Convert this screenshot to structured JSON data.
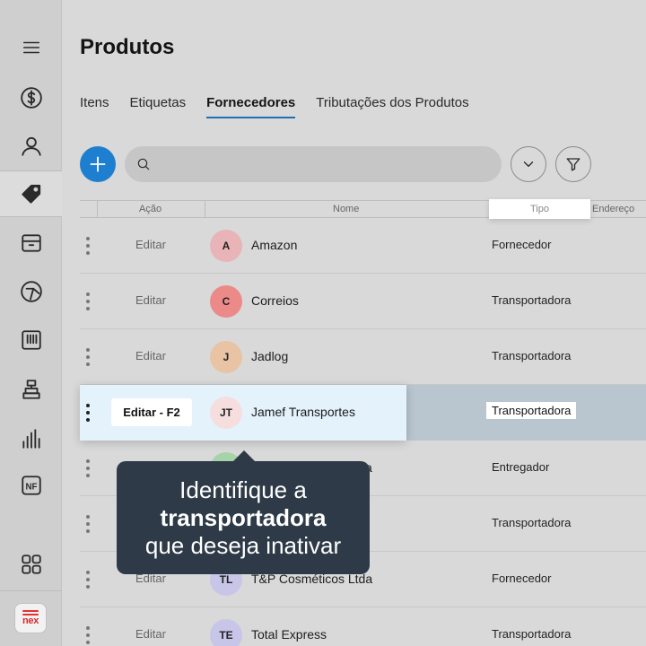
{
  "page": {
    "title": "Produtos"
  },
  "tabs": [
    {
      "label": "Itens",
      "active": false
    },
    {
      "label": "Etiquetas",
      "active": false
    },
    {
      "label": "Fornecedores",
      "active": true
    },
    {
      "label": "Tributações dos Produtos",
      "active": false
    }
  ],
  "sidebar": {
    "items": [
      {
        "icon": "menu-icon"
      },
      {
        "icon": "dollar-icon"
      },
      {
        "icon": "user-icon"
      },
      {
        "icon": "tag-icon",
        "active": true
      },
      {
        "icon": "box-icon"
      },
      {
        "icon": "pie-chart-icon"
      },
      {
        "icon": "barcode-icon"
      },
      {
        "icon": "register-icon"
      },
      {
        "icon": "bar-chart-icon"
      },
      {
        "icon": "nf-icon",
        "label": "NF"
      },
      {
        "icon": "apps-grid-icon"
      }
    ],
    "logo_text": "nex"
  },
  "toolbar": {
    "search_placeholder": ""
  },
  "table": {
    "columns": {
      "acao": "Ação",
      "nome": "Nome",
      "tipo": "Tipo",
      "endereco": "Endereço"
    },
    "edit_label": "Editar",
    "rows": [
      {
        "initials": "A",
        "name": "Amazon",
        "tipo": "Fornecedor",
        "color": "#e8b4b8"
      },
      {
        "initials": "C",
        "name": "Correios",
        "tipo": "Transportadora",
        "color": "#ec8a8a"
      },
      {
        "initials": "J",
        "name": "Jadlog",
        "tipo": "Transportadora",
        "color": "#e8c4a4"
      },
      {
        "initials": "JT",
        "name": "Jamef Transportes",
        "tipo": "Transportadora",
        "color": "#f6dede",
        "edit_label": "Editar - F2"
      },
      {
        "initials": "",
        "name": "",
        "tipo": "Entregador",
        "color": "#a6d4a8",
        "name_tail": "a"
      },
      {
        "initials": "",
        "name": "",
        "tipo": "Transportadora",
        "color": "#c8c8c8"
      },
      {
        "initials": "TL",
        "name": "T&P Cosméticos Ltda",
        "tipo": "Fornecedor",
        "color": "#c8c6e8"
      },
      {
        "initials": "TE",
        "name": "Total Express",
        "tipo": "Transportadora",
        "color": "#c8c6e8"
      }
    ]
  },
  "tooltip": {
    "line1": "Identifique a",
    "line2": "transportadora",
    "line3": "que deseja inativar"
  }
}
